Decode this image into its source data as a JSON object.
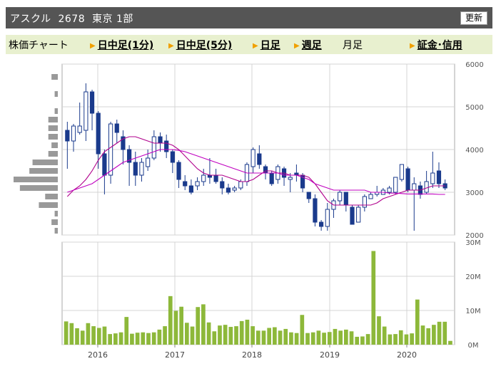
{
  "header": {
    "title": "アスクル  2678  東京 1部",
    "refresh_label": "更新"
  },
  "menu": [
    {
      "label": "株価チャート",
      "link": false,
      "arrow": false
    },
    {
      "label": "日中足(1分)",
      "link": true,
      "arrow": true
    },
    {
      "label": "日中足(5分)",
      "link": true,
      "arrow": true
    },
    {
      "label": "日足",
      "link": true,
      "arrow": true
    },
    {
      "label": "週足",
      "link": true,
      "arrow": true
    },
    {
      "label": "月足",
      "link": false,
      "arrow": false
    },
    {
      "label": "証金･信用",
      "link": true,
      "arrow": true
    }
  ],
  "colors": {
    "up": "#ffffff",
    "down": "#1a3a8c",
    "ma_short": "#b0008c",
    "ma_long": "#c000c0",
    "volume": "#8db83a",
    "profile": "#999999"
  },
  "chart_data": [
    {
      "type": "candlestick",
      "title": "",
      "ylim": [
        2000,
        6000
      ],
      "y_ticks": [
        "2000",
        "3000",
        "4000",
        "5000",
        "6000"
      ],
      "x_tick_labels": [
        "2016",
        "2017",
        "2018",
        "2019",
        "2020"
      ],
      "candles": [
        [
          4450,
          4200,
          4650,
          3550
        ],
        [
          4200,
          4550,
          4600,
          3950
        ],
        [
          4400,
          4550,
          5100,
          4350
        ],
        [
          4450,
          5350,
          5550,
          4200
        ],
        [
          5350,
          4850,
          5400,
          4450
        ],
        [
          4850,
          3900,
          4900,
          3550
        ],
        [
          3900,
          3400,
          4000,
          2950
        ],
        [
          3400,
          4600,
          4650,
          3200
        ],
        [
          4600,
          4400,
          4700,
          4150
        ],
        [
          4300,
          4000,
          4450,
          3650
        ],
        [
          4000,
          3700,
          4100,
          3150
        ],
        [
          3700,
          3400,
          3950,
          3150
        ],
        [
          3400,
          3700,
          3800,
          3250
        ],
        [
          3600,
          3800,
          4000,
          3500
        ],
        [
          3800,
          4300,
          4450,
          3750
        ],
        [
          4300,
          4150,
          4400,
          3950
        ],
        [
          4200,
          3950,
          4350,
          3800
        ],
        [
          3950,
          3700,
          4000,
          3450
        ],
        [
          3700,
          3300,
          3750,
          3100
        ],
        [
          3250,
          3150,
          3400,
          3050
        ],
        [
          3150,
          3000,
          3300,
          2950
        ],
        [
          3150,
          3250,
          3350,
          3050
        ],
        [
          3250,
          3400,
          3550,
          3150
        ],
        [
          3400,
          3350,
          3800,
          3200
        ],
        [
          3400,
          3250,
          3550,
          3200
        ],
        [
          3250,
          3100,
          3350,
          2950
        ],
        [
          3100,
          3000,
          3200,
          2950
        ],
        [
          3050,
          3100,
          3150,
          3000
        ],
        [
          3100,
          3250,
          3300,
          3050
        ],
        [
          3250,
          3650,
          3700,
          3150
        ],
        [
          3600,
          4000,
          4050,
          3450
        ],
        [
          3900,
          3650,
          4100,
          3550
        ],
        [
          3600,
          3450,
          3650,
          3300
        ],
        [
          3450,
          3200,
          3500,
          3150
        ],
        [
          3300,
          3600,
          3650,
          3200
        ],
        [
          3550,
          3350,
          3600,
          3150
        ],
        [
          3300,
          3350,
          3450,
          3000
        ],
        [
          3450,
          3400,
          3650,
          3250
        ],
        [
          3400,
          3100,
          3450,
          3000
        ],
        [
          3000,
          2850,
          3000,
          2750
        ],
        [
          2850,
          2300,
          2950,
          2200
        ],
        [
          2300,
          2200,
          2350,
          2100
        ],
        [
          2200,
          2600,
          2750,
          2100
        ],
        [
          2600,
          2800,
          2850,
          2400
        ],
        [
          2800,
          3000,
          3050,
          2700
        ],
        [
          3000,
          2700,
          3000,
          2550
        ],
        [
          2650,
          2250,
          2700,
          2250
        ],
        [
          2300,
          2650,
          2700,
          2300
        ],
        [
          2650,
          2900,
          2950,
          2550
        ],
        [
          2850,
          2950,
          3000,
          2850
        ],
        [
          2950,
          3000,
          3150,
          2900
        ],
        [
          2950,
          3050,
          3100,
          2950
        ],
        [
          3000,
          3100,
          3150,
          2950
        ],
        [
          3000,
          3350,
          3350,
          2950
        ],
        [
          3300,
          3650,
          3650,
          3250
        ],
        [
          3550,
          3050,
          3600,
          3000
        ],
        [
          3050,
          3200,
          3350,
          2100
        ],
        [
          3150,
          2950,
          3250,
          2850
        ],
        [
          3000,
          3250,
          3500,
          2950
        ],
        [
          3200,
          3450,
          3950,
          3100
        ],
        [
          3500,
          3200,
          3700,
          3100
        ],
        [
          3200,
          3100,
          3300,
          3050
        ]
      ],
      "ma_short": [
        2900,
        3050,
        3150,
        3300,
        3500,
        3750,
        3950,
        4050,
        4150,
        4250,
        4300,
        4300,
        4250,
        4200,
        4150,
        4150,
        4150,
        4100,
        4000,
        3850,
        3700,
        3550,
        3450,
        3400,
        3400,
        3400,
        3350,
        3300,
        3250,
        3250,
        3300,
        3400,
        3500,
        3500,
        3450,
        3450,
        3400,
        3400,
        3400,
        3350,
        3200,
        3000,
        2800,
        2700,
        2700,
        2700,
        2700,
        2700,
        2700,
        2700,
        2750,
        2850,
        2900,
        2950,
        3000,
        3050,
        3050,
        3050,
        3100,
        3150,
        3150,
        3150
      ],
      "ma_long": [
        3000,
        3050,
        3100,
        3150,
        3200,
        3300,
        3400,
        3500,
        3600,
        3700,
        3750,
        3800,
        3850,
        3900,
        3950,
        4000,
        4000,
        4000,
        3980,
        3950,
        3900,
        3850,
        3800,
        3750,
        3700,
        3650,
        3600,
        3550,
        3500,
        3450,
        3450,
        3450,
        3450,
        3450,
        3450,
        3400,
        3400,
        3400,
        3350,
        3300,
        3200,
        3150,
        3100,
        3050,
        3050,
        3050,
        3050,
        3050,
        3050,
        3000,
        3000,
        3000,
        2980,
        2980,
        2970,
        2960,
        2960,
        2960,
        2960,
        2960,
        2950,
        2950
      ]
    },
    {
      "type": "bar",
      "title": "",
      "ylim": [
        0,
        30
      ],
      "y_ticks": [
        "0M",
        "10M",
        "20M",
        "30M"
      ],
      "x_tick_labels": [
        "2016",
        "2017",
        "2018",
        "2019",
        "2020"
      ],
      "values": [
        6.8,
        6.3,
        4.8,
        4.1,
        6.3,
        5.4,
        4.9,
        5.3,
        3.1,
        3.3,
        3.6,
        8.1,
        3.2,
        3.5,
        3.6,
        3.4,
        3.6,
        4.4,
        5.4,
        14.2,
        9.9,
        11.1,
        6.4,
        5.3,
        11.0,
        11.8,
        6.5,
        3.9,
        5.6,
        5.8,
        5.2,
        5.4,
        6.9,
        7.3,
        5.4,
        4.1,
        4.1,
        4.9,
        5.1,
        4.1,
        4.6,
        3.6,
        3.4,
        8.7,
        3.4,
        3.6,
        4.1,
        3.5,
        3.7,
        4.6,
        4.1,
        4.4,
        3.9,
        2.3,
        2.4,
        3.1,
        27.4,
        8.3,
        5.3,
        3.0,
        3.1,
        4.2,
        3.0,
        3.3,
        13.2,
        5.6,
        4.8,
        5.8,
        6.7,
        6.7,
        1.1
      ]
    },
    {
      "type": "bar",
      "orientation": "horizontal",
      "title": "",
      "price_levels": [
        5700,
        5500,
        5300,
        5100,
        4900,
        4700,
        4500,
        4300,
        4100,
        3900,
        3700,
        3500,
        3300,
        3100,
        2900,
        2700,
        2500,
        2300,
        2100
      ],
      "values": [
        2,
        0,
        1,
        0,
        1,
        3,
        3,
        3,
        2,
        3,
        8,
        9,
        14,
        12,
        4,
        6,
        1,
        2,
        1
      ]
    }
  ]
}
